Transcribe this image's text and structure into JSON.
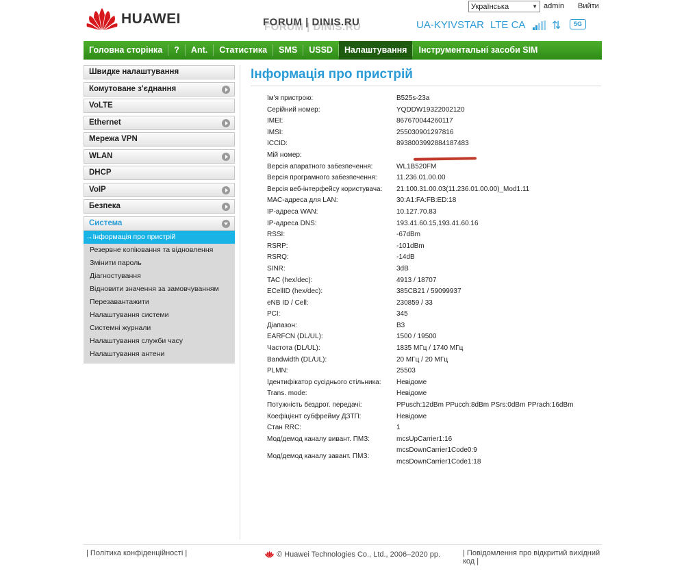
{
  "header": {
    "brand": "HUAWEI",
    "watermark": "FORUM | DINIS.RU",
    "language": "Українська",
    "user": "admin",
    "logout": "Вийти",
    "operator": "UA-KYIVSTAR",
    "network": "LTE CA",
    "wifi_badge": "5G",
    "icons": [
      "huawei-logo",
      "signal-bars-icon",
      "traffic-arrows-icon",
      "wifi-5g-icon"
    ]
  },
  "nav": [
    {
      "label": "Головна сторінка"
    },
    {
      "label": "?"
    },
    {
      "label": "Ant."
    },
    {
      "label": "Статистика"
    },
    {
      "label": "SMS"
    },
    {
      "label": "USSD"
    },
    {
      "label": "Налаштування",
      "active": true
    },
    {
      "label": "Інструментальні засоби SIM"
    }
  ],
  "sidebar": {
    "items": [
      {
        "label": "Швидке налаштування"
      },
      {
        "label": "Комутоване з'єднання",
        "expandable": true
      },
      {
        "label": "VoLTE"
      },
      {
        "label": "Ethernet",
        "expandable": true
      },
      {
        "label": "Мережа VPN"
      },
      {
        "label": "WLAN",
        "expandable": true
      },
      {
        "label": "DHCP"
      },
      {
        "label": "VoIP",
        "expandable": true
      },
      {
        "label": "Безпека",
        "expandable": true
      },
      {
        "label": "Система",
        "expandable": true,
        "open": true
      }
    ],
    "submenu": [
      "→Інформація про пристрій",
      "Резервне копіювання та відновлення",
      "Змінити пароль",
      "Діагностування",
      "Відновити значення за замовчуванням",
      "Перезавантажити",
      "Налаштування системи",
      "Системні журнали",
      "Налаштування служби часу",
      "Налаштування антени"
    ]
  },
  "main": {
    "title": "Інформація про пристрій",
    "rows": [
      {
        "label": "Ім'я пристрою:",
        "value": "B525s-23a"
      },
      {
        "label": "Серійний номер:",
        "value": "YQDDW19322002120"
      },
      {
        "label": "IMEI:",
        "value": "867670044260117"
      },
      {
        "label": "IMSI:",
        "value": "255030901297816"
      },
      {
        "label": "ICCID:",
        "value": "8938003992884187483"
      },
      {
        "label": "Мій номер:",
        "value": ""
      },
      {
        "label": "Версія апаратного забезпечення:",
        "value": "WL1B520FM"
      },
      {
        "label": "Версія програмного забезпечення:",
        "value": "11.236.01.00.00"
      },
      {
        "label": "Версія веб-інтерфейсу користувача:",
        "value": "21.100.31.00.03(11.236.01.00.00)_Mod1.11"
      },
      {
        "label": "MAC-адреса для LAN:",
        "value": "30:A1:FA:FB:ED:18"
      },
      {
        "label": "IP-адреса WAN:",
        "value": "10.127.70.83"
      },
      {
        "label": "IP-адреса DNS:",
        "value": "193.41.60.15,193.41.60.16"
      },
      {
        "label": "RSSI:",
        "value": "-67dBm"
      },
      {
        "label": "RSRP:",
        "value": "-101dBm"
      },
      {
        "label": "RSRQ:",
        "value": "-14dB"
      },
      {
        "label": "SINR:",
        "value": "3dB"
      },
      {
        "label": "TAC (hex/dec):",
        "value": "4913 / 18707"
      },
      {
        "label": "ECellID (hex/dec):",
        "value": "385CB21 / 59099937"
      },
      {
        "label": "eNB ID / Cell:",
        "value": "230859 / 33"
      },
      {
        "label": "PCI:",
        "value": "345"
      },
      {
        "label": "Діапазон:",
        "value": "B3"
      },
      {
        "label": "EARFCN (DL/UL):",
        "value": "1500 / 19500"
      },
      {
        "label": "Частота (DL/UL):",
        "value": "1835 МГц / 1740 МГц"
      },
      {
        "label": "Bandwidth (DL/UL):",
        "value": "20 МГц / 20 МГц"
      },
      {
        "label": "PLMN:",
        "value": "25503"
      },
      {
        "label": "Ідентифікатор сусідньо­го стільника:",
        "value": "Невідоме"
      },
      {
        "label": "Trans. mode:",
        "value": "Невідоме"
      },
      {
        "label": "Потужність бездрот. передачі:",
        "value": "PPusch:12dBm PPucch:8dBm PSrs:0dBm PPrach:16dBm"
      },
      {
        "label": "Коефіцієнт субфрейму ДЗТП:",
        "value": "Невідоме"
      },
      {
        "label": "Стан RRC:",
        "value": "1"
      },
      {
        "label": "Мод/демод каналу вивант. ПМЗ:",
        "value": "mcsUpCarrier1:16"
      },
      {
        "label": "Мод/демод каналу завант. ПМЗ:",
        "value": "mcsDownCarrier1Code0:9\nmcsDownCarrier1Code1:18"
      }
    ]
  },
  "footer": {
    "privacy": "Політика конфіденційності",
    "copyright": "© Huawei Technologies Co., Ltd., 2006–2020 рр.",
    "opensource": "Повідомлення про відкритий вихідний код"
  },
  "colors": {
    "accent_blue": "#2a9bd6",
    "nav_green": "#3a9d22",
    "nav_active": "#1f5c12",
    "submenu_active": "#1ab3e6",
    "brand_red": "#d7191e"
  }
}
